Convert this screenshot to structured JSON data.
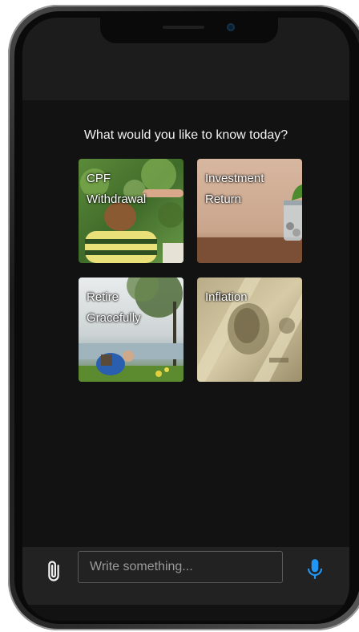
{
  "prompt": "What would you like to know today?",
  "cards": [
    {
      "label_line1": "CPF",
      "label_line2": "Withdrawal"
    },
    {
      "label_line1": "Investment",
      "label_line2": "Return"
    },
    {
      "label_line1": "Retire",
      "label_line2": "Gracefully"
    },
    {
      "label_line1": "Inflation",
      "label_line2": ""
    }
  ],
  "composer": {
    "placeholder": "Write something...",
    "attach_icon": "paperclip-icon",
    "mic_icon": "microphone-icon",
    "mic_color": "#2196f3"
  }
}
